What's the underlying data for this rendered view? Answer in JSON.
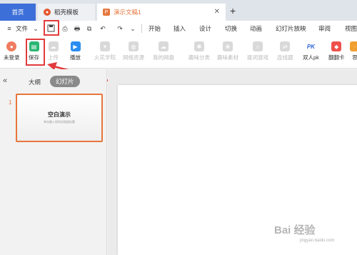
{
  "tabs": {
    "home": "首页",
    "templates": "稻壳模板",
    "doc": "演示文稿1",
    "doc_icon": "P"
  },
  "menu": {
    "file": "文件",
    "items": [
      "开始",
      "插入",
      "设计",
      "切换",
      "动画",
      "幻灯片放映",
      "审阅",
      "视图"
    ]
  },
  "ribbon": {
    "login": "未登录",
    "save": "保存",
    "upload": "上传",
    "play": "播放",
    "huohua": "火花学院",
    "network": "网络资源",
    "cloud": "我的网盘",
    "fun_class": "趣味分类",
    "fun_material": "趣味素材",
    "game": "拨词游戏",
    "connect": "连线题",
    "pk": "双人pk",
    "flip": "翻翻卡",
    "more": "思"
  },
  "panel": {
    "outline": "大纲",
    "slides": "幻灯片",
    "slide_number": "1",
    "thumb_title": "空白演示",
    "thumb_subtitle": "单击输入您的封面副标题"
  },
  "watermark": {
    "text": "Bai 经验",
    "sub": "jingyan.baidu.com"
  },
  "colors": {
    "accent": "#e6763c",
    "annotation": "#e23b3b",
    "home_tab": "#3d6fd9"
  }
}
